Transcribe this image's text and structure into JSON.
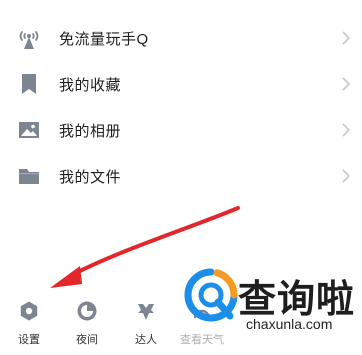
{
  "menu": {
    "items": [
      {
        "label": "免流量玩手Q",
        "icon": "antenna-icon"
      },
      {
        "label": "我的收藏",
        "icon": "bookmark-icon"
      },
      {
        "label": "我的相册",
        "icon": "image-icon"
      },
      {
        "label": "我的文件",
        "icon": "folder-icon"
      }
    ]
  },
  "bottom_bar": {
    "items": [
      {
        "label": "设置",
        "icon": "settings-icon"
      },
      {
        "label": "夜间",
        "icon": "moon-icon"
      },
      {
        "label": "达人",
        "icon": "badge-icon"
      },
      {
        "label": "查看天气",
        "icon": "weather-icon"
      }
    ]
  },
  "watermark": {
    "chinese": "查询啦",
    "english": "chaxunla.com"
  },
  "colors": {
    "icon_gray": "#7d8591",
    "arrow_red": "#e3262a",
    "logo_blue": "#1a8ee8",
    "logo_orange": "#f59a23"
  }
}
